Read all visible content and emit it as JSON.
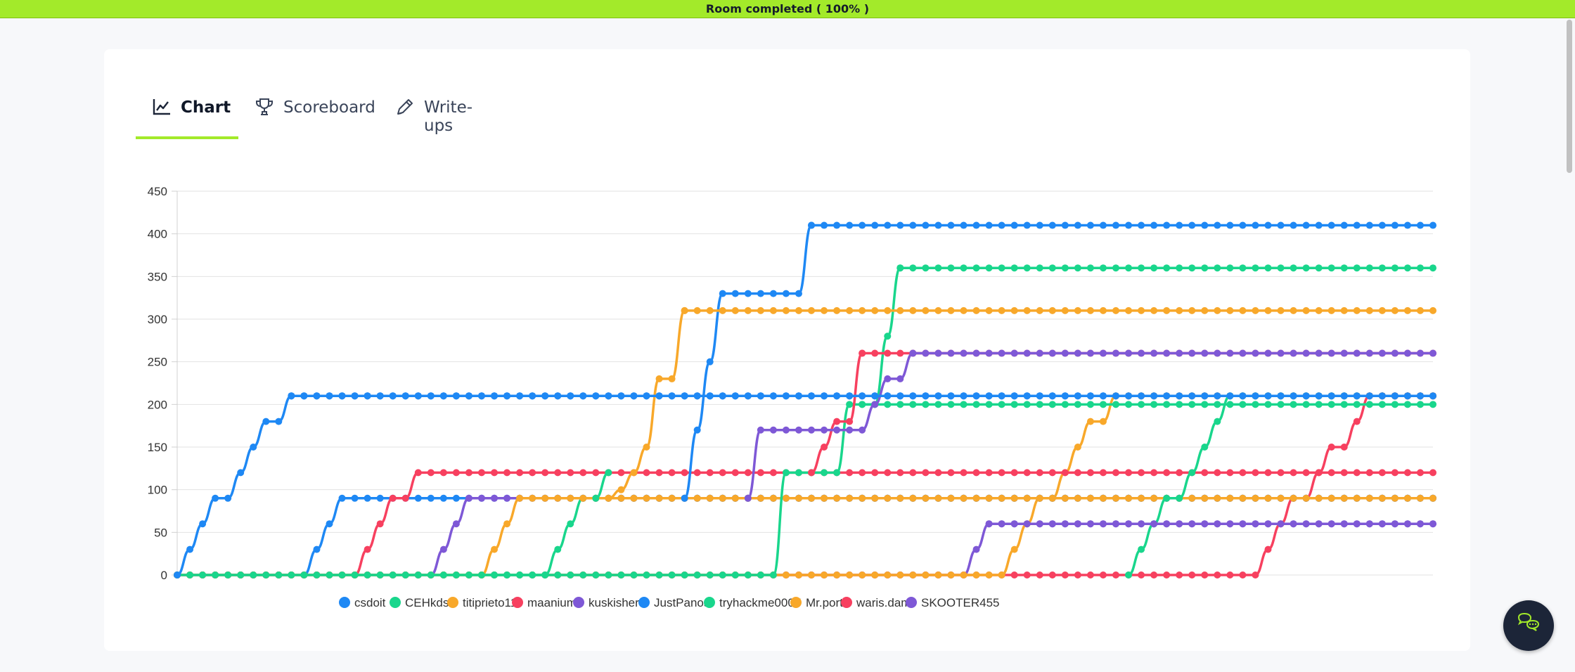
{
  "banner": {
    "text": "Room completed ( 100% )",
    "color": "#a3ea2a"
  },
  "tabs": [
    {
      "label": "Chart",
      "icon": "line-chart-icon",
      "active": true
    },
    {
      "label": "Scoreboard",
      "icon": "trophy-icon",
      "active": false
    },
    {
      "label": "Write-ups",
      "icon": "pencil-icon",
      "active": false
    }
  ],
  "chat": {
    "icon": "chat-bubbles-icon"
  },
  "chart_data": {
    "type": "line",
    "ylim": [
      0,
      450
    ],
    "yticks": [
      0,
      50,
      100,
      150,
      200,
      250,
      300,
      350,
      400,
      450
    ],
    "grid": true,
    "legend_position": "bottom",
    "points_per_series": 100,
    "series": [
      {
        "name": "csdoit",
        "color": "#1e88f4",
        "steps": [
          [
            0,
            0
          ],
          [
            1,
            30
          ],
          [
            2,
            60
          ],
          [
            3,
            90
          ],
          [
            4,
            90
          ],
          [
            5,
            120
          ],
          [
            6,
            150
          ],
          [
            7,
            180
          ],
          [
            8,
            180
          ],
          [
            9,
            210
          ]
        ]
      },
      {
        "name": "CEHkds",
        "color": "#19d68c",
        "steps": [
          [
            0,
            0
          ],
          [
            34,
            0
          ],
          [
            35,
            0
          ],
          [
            43,
            0
          ],
          [
            44,
            0
          ],
          [
            47,
            0
          ],
          [
            48,
            120
          ],
          [
            51,
            120
          ],
          [
            52,
            120
          ],
          [
            53,
            200
          ],
          [
            54,
            200
          ],
          [
            55,
            200
          ],
          [
            56,
            200
          ],
          [
            57,
            200
          ],
          [
            58,
            200
          ],
          [
            59,
            200
          ],
          [
            60,
            200
          ],
          [
            61,
            200
          ],
          [
            62,
            200
          ],
          [
            63,
            200
          ],
          [
            64,
            200
          ],
          [
            65,
            200
          ],
          [
            66,
            200
          ],
          [
            67,
            200
          ],
          [
            68,
            200
          ],
          [
            69,
            200
          ],
          [
            70,
            200
          ],
          [
            71,
            200
          ],
          [
            72,
            200
          ],
          [
            73,
            200
          ],
          [
            74,
            200
          ],
          [
            75,
            200
          ],
          [
            76,
            200
          ],
          [
            77,
            200
          ],
          [
            78,
            200
          ],
          [
            79,
            200
          ],
          [
            80,
            200
          ],
          [
            81,
            200
          ],
          [
            82,
            200
          ],
          [
            83,
            200
          ],
          [
            84,
            200
          ],
          [
            85,
            200
          ],
          [
            86,
            200
          ],
          [
            87,
            200
          ],
          [
            88,
            200
          ],
          [
            89,
            200
          ],
          [
            90,
            200
          ],
          [
            91,
            200
          ],
          [
            92,
            200
          ],
          [
            93,
            200
          ],
          [
            94,
            200
          ],
          [
            95,
            200
          ],
          [
            96,
            200
          ],
          [
            97,
            200
          ],
          [
            98,
            200
          ],
          [
            99,
            200
          ]
        ]
      },
      {
        "name": "titiprieto11",
        "color": "#f8a82a",
        "steps": [
          [
            0,
            0
          ],
          [
            24,
            0
          ],
          [
            25,
            30
          ],
          [
            26,
            60
          ],
          [
            27,
            90
          ],
          [
            28,
            90
          ],
          [
            29,
            90
          ],
          [
            30,
            90
          ],
          [
            31,
            90
          ],
          [
            32,
            90
          ],
          [
            33,
            90
          ],
          [
            34,
            90
          ],
          [
            35,
            90
          ],
          [
            36,
            90
          ],
          [
            37,
            90
          ],
          [
            38,
            90
          ],
          [
            39,
            90
          ],
          [
            40,
            90
          ],
          [
            41,
            90
          ],
          [
            42,
            90
          ],
          [
            43,
            90
          ],
          [
            44,
            90
          ],
          [
            45,
            90
          ],
          [
            46,
            90
          ],
          [
            47,
            90
          ],
          [
            48,
            90
          ],
          [
            49,
            90
          ],
          [
            50,
            90
          ],
          [
            51,
            90
          ],
          [
            52,
            90
          ],
          [
            53,
            90
          ],
          [
            54,
            90
          ],
          [
            55,
            90
          ],
          [
            56,
            90
          ],
          [
            57,
            90
          ],
          [
            58,
            90
          ],
          [
            59,
            90
          ],
          [
            60,
            90
          ],
          [
            61,
            90
          ],
          [
            62,
            90
          ],
          [
            63,
            90
          ],
          [
            64,
            90
          ],
          [
            65,
            90
          ],
          [
            66,
            90
          ],
          [
            67,
            90
          ],
          [
            68,
            90
          ],
          [
            69,
            90
          ],
          [
            70,
            90
          ],
          [
            71,
            90
          ],
          [
            72,
            90
          ],
          [
            73,
            90
          ],
          [
            74,
            90
          ],
          [
            75,
            90
          ],
          [
            76,
            90
          ],
          [
            77,
            90
          ],
          [
            78,
            90
          ],
          [
            79,
            90
          ],
          [
            80,
            90
          ],
          [
            81,
            90
          ],
          [
            82,
            90
          ],
          [
            83,
            90
          ],
          [
            84,
            90
          ],
          [
            85,
            90
          ],
          [
            86,
            90
          ],
          [
            87,
            90
          ],
          [
            88,
            90
          ],
          [
            89,
            90
          ],
          [
            90,
            90
          ],
          [
            91,
            90
          ],
          [
            92,
            90
          ],
          [
            93,
            90
          ],
          [
            94,
            90
          ],
          [
            95,
            90
          ],
          [
            96,
            90
          ],
          [
            97,
            90
          ],
          [
            98,
            90
          ],
          [
            99,
            90
          ]
        ]
      },
      {
        "name": "maanium",
        "color": "#f7405f",
        "steps": [
          [
            0,
            0
          ],
          [
            14,
            0
          ],
          [
            15,
            30
          ],
          [
            16,
            60
          ],
          [
            17,
            90
          ],
          [
            18,
            90
          ],
          [
            19,
            120
          ]
        ]
      },
      {
        "name": "kuskishere",
        "color": "#7e58d6",
        "steps": [
          [
            0,
            0
          ],
          [
            20,
            0
          ],
          [
            21,
            30
          ],
          [
            22,
            60
          ],
          [
            23,
            90
          ]
        ]
      },
      {
        "name": "JustPanos",
        "color": "#1e88f4",
        "steps": [
          [
            0,
            0
          ],
          [
            10,
            0
          ],
          [
            11,
            30
          ],
          [
            12,
            60
          ],
          [
            13,
            90
          ]
        ]
      },
      {
        "name": "tryhackme0007",
        "color": "#19d68c",
        "steps": [
          [
            0,
            0
          ],
          [
            29,
            0
          ],
          [
            30,
            30
          ],
          [
            31,
            60
          ],
          [
            32,
            90
          ]
        ]
      },
      {
        "name": "Mr.port",
        "color": "#f8a82a",
        "steps": [
          [
            0,
            0
          ],
          [
            65,
            0
          ],
          [
            66,
            30
          ],
          [
            67,
            60
          ],
          [
            68,
            90
          ],
          [
            69,
            90
          ],
          [
            70,
            120
          ],
          [
            71,
            150
          ],
          [
            72,
            180
          ],
          [
            73,
            180
          ],
          [
            74,
            210
          ]
        ]
      },
      {
        "name": "waris.dam",
        "color": "#f7405f",
        "steps": [
          [
            0,
            0
          ],
          [
            85,
            0
          ],
          [
            86,
            30
          ],
          [
            87,
            60
          ],
          [
            88,
            90
          ],
          [
            89,
            90
          ],
          [
            90,
            120
          ],
          [
            91,
            150
          ],
          [
            92,
            150
          ],
          [
            93,
            180
          ],
          [
            94,
            210
          ]
        ]
      },
      {
        "name": "SKOOTER455",
        "color": "#7e58d6",
        "steps": [
          [
            0,
            0
          ],
          [
            62,
            0
          ],
          [
            63,
            30
          ],
          [
            64,
            60
          ]
        ]
      }
    ],
    "overlay_lines": [
      {
        "series": "titiprieto11",
        "from": 34,
        "steps": [
          [
            34,
            90
          ],
          [
            35,
            100
          ],
          [
            36,
            120
          ],
          [
            37,
            150
          ],
          [
            38,
            230
          ],
          [
            39,
            230
          ],
          [
            40,
            310
          ]
        ]
      },
      {
        "series": "CEHkds",
        "from": 33,
        "steps": [
          [
            33,
            90
          ],
          [
            34,
            120
          ]
        ]
      },
      {
        "series": "JustPanos",
        "from": 40,
        "steps": [
          [
            40,
            90
          ],
          [
            41,
            170
          ],
          [
            42,
            250
          ],
          [
            43,
            330
          ],
          [
            44,
            330
          ],
          [
            45,
            330
          ],
          [
            46,
            330
          ],
          [
            47,
            330
          ],
          [
            48,
            330
          ],
          [
            49,
            330
          ],
          [
            50,
            410
          ]
        ]
      },
      {
        "series": "CEHkds",
        "from": 54,
        "steps": [
          [
            54,
            200
          ],
          [
            55,
            200
          ],
          [
            56,
            280
          ],
          [
            57,
            360
          ]
        ]
      },
      {
        "series": "maanium",
        "from": 50,
        "steps": [
          [
            50,
            120
          ],
          [
            51,
            150
          ],
          [
            52,
            180
          ],
          [
            53,
            180
          ],
          [
            54,
            260
          ]
        ]
      },
      {
        "series": "kuskishere",
        "from": 45,
        "steps": [
          [
            45,
            90
          ],
          [
            46,
            170
          ],
          [
            47,
            170
          ],
          [
            48,
            170
          ],
          [
            49,
            170
          ],
          [
            50,
            170
          ],
          [
            51,
            170
          ],
          [
            52,
            170
          ],
          [
            53,
            170
          ],
          [
            54,
            170
          ],
          [
            55,
            200
          ],
          [
            56,
            230
          ],
          [
            57,
            230
          ],
          [
            58,
            260
          ]
        ]
      },
      {
        "series": "tryhackme0007",
        "from": 75,
        "steps": [
          [
            75,
            0
          ],
          [
            76,
            30
          ],
          [
            77,
            60
          ],
          [
            78,
            90
          ],
          [
            79,
            90
          ],
          [
            80,
            120
          ],
          [
            81,
            150
          ],
          [
            82,
            180
          ],
          [
            83,
            210
          ]
        ]
      }
    ]
  }
}
